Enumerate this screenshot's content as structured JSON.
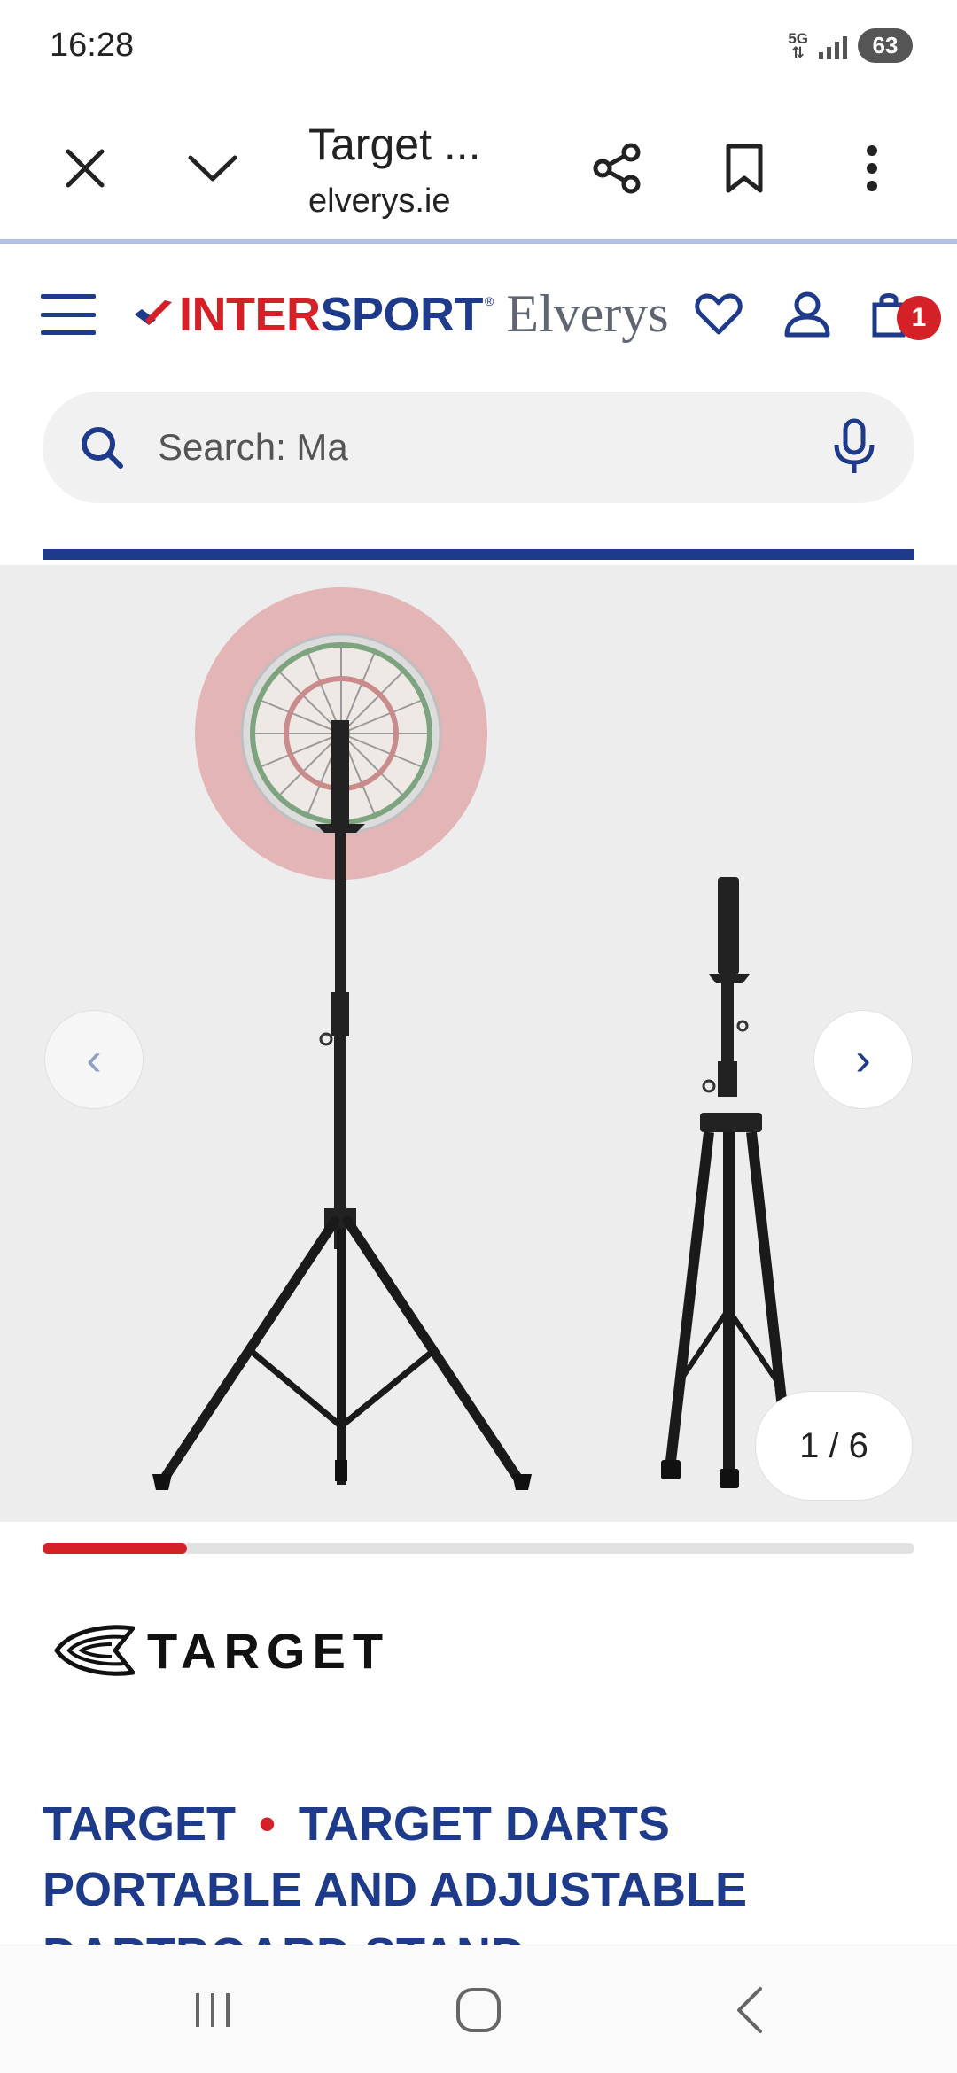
{
  "status_bar": {
    "time": "16:28",
    "network": "5G",
    "battery": "63"
  },
  "browser": {
    "tab_title": "Target ...",
    "url": "elverys.ie",
    "icons": [
      "close-icon",
      "chevron-down-icon",
      "share-icon",
      "bookmark-icon",
      "more-vert-icon"
    ]
  },
  "site": {
    "logo_inter": "INTER",
    "logo_sport": "SPORT",
    "logo_reg": "®",
    "logo_elverys": "Elverys",
    "cart_count": "1",
    "brand_blue": "#1e3a8a",
    "brand_red": "#d42027"
  },
  "search": {
    "placeholder": "Search: Ma"
  },
  "gallery": {
    "counter": "1 / 6",
    "prev_label": "‹",
    "next_label": "›",
    "progress": 0.166
  },
  "product": {
    "brand_logo_text": "TARGET",
    "brand": "TARGET",
    "separator": "•",
    "name": "TARGET DARTS PORTABLE AND ADJUSTABLE DARTBOARD STAND"
  }
}
